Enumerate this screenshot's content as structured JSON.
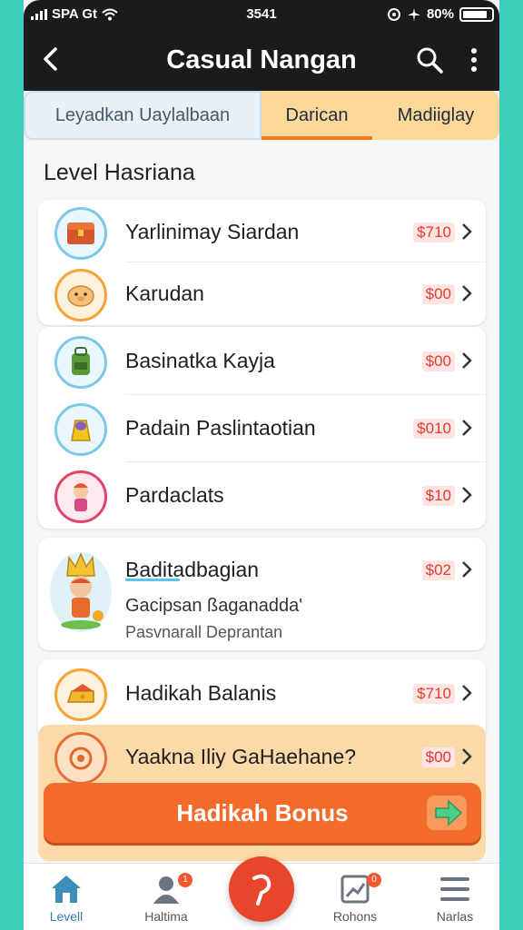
{
  "status_bar": {
    "carrier": "SPA Gt",
    "time": "3541",
    "battery": "80%"
  },
  "header": {
    "title": "Casual Nangan"
  },
  "tabs": [
    {
      "label": "Leyadkan Uaylalbaan"
    },
    {
      "label": "Darican"
    },
    {
      "label": "Madiiglay"
    }
  ],
  "section": {
    "title": "Level Hasriana"
  },
  "items": [
    {
      "name": "Yarlinimay Siardan",
      "price": "$710",
      "icon": "treasure-chest-icon"
    },
    {
      "name": "Karudan",
      "price": "$00",
      "icon": "pig-icon"
    },
    {
      "name": "Basinatka Kayja",
      "price": "$00",
      "icon": "backpack-icon"
    },
    {
      "name": "Padain Paslintaotian",
      "price": "$010",
      "icon": "lantern-icon"
    },
    {
      "name": "Pardaclats",
      "price": "$10",
      "icon": "character-icon"
    },
    {
      "name": "Baditadbagian",
      "price": "$02",
      "sub1": "Gacipsan ßaganadda'",
      "sub2": "Pasvnarall Deprantan",
      "icon": "king-character-icon"
    },
    {
      "name": "Hadikah Balanis",
      "price": "$710",
      "icon": "cheese-icon"
    }
  ],
  "bonus": {
    "question": "Yaakna Iliy GaHaehane?",
    "price": "$00",
    "button": "Hadikah Bonus"
  },
  "nav": [
    {
      "label": "Levell",
      "icon": "home-icon"
    },
    {
      "label": "Haltima",
      "icon": "profile-icon",
      "badge": "1"
    },
    {
      "label": "",
      "icon": "fab-icon"
    },
    {
      "label": "Rohons",
      "icon": "chart-icon",
      "badge": "0"
    },
    {
      "label": "Narlas",
      "icon": "menu-icon"
    }
  ],
  "colors": {
    "accent": "#f26b2a",
    "header": "#1b1b1b",
    "background": "#3fcdbb",
    "tab_active": "#fbd79a"
  }
}
